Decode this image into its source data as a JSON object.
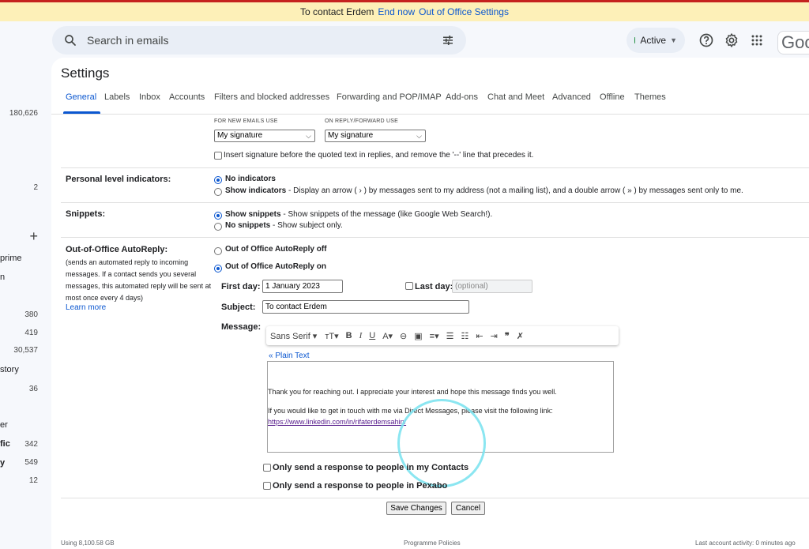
{
  "banner": {
    "text": "To contact Erdem",
    "end_now": "End now",
    "settings_link": "Out of Office Settings"
  },
  "left_sidebar": {
    "counts": [
      "180,626",
      "2",
      "380",
      "419",
      "30,537",
      "36",
      "342",
      "549",
      "12"
    ],
    "labels": [
      "prime",
      "n",
      "story",
      "er",
      "fic",
      "y"
    ],
    "plus": "+"
  },
  "header": {
    "search_placeholder": "Search in emails",
    "status": "Active",
    "logo": "Goog"
  },
  "settings": {
    "title": "Settings",
    "tabs": [
      "General",
      "Labels",
      "Inbox",
      "Accounts",
      "Filters and blocked addresses",
      "Forwarding and POP/IMAP",
      "Add-ons",
      "Chat and Meet",
      "Advanced",
      "Offline",
      "Themes"
    ]
  },
  "signature": {
    "new_label": "FOR NEW EMAILS USE",
    "reply_label": "ON REPLY/FORWARD USE",
    "new_value": "My signature",
    "reply_value": "My signature",
    "insert_text": "Insert signature before the quoted text in replies, and remove the '--' line that precedes it."
  },
  "personal_indicators": {
    "label": "Personal level indicators:",
    "opt1": "No indicators",
    "opt2": "Show indicators",
    "opt2_desc": " - Display an arrow ( › ) by messages sent to my address (not a mailing list), and a double arrow ( » ) by messages sent only to me."
  },
  "snippets": {
    "label": "Snippets:",
    "opt1": "Show snippets",
    "opt1_desc": " - Show snippets of the message (like Google Web Search!).",
    "opt2": "No snippets",
    "opt2_desc": " - Show subject only."
  },
  "autoreply": {
    "label": "Out-of-Office AutoReply:",
    "desc": "(sends an automated reply to incoming messages. If a contact sends you several messages, this automated reply will be sent at most once every 4 days)",
    "learn_more": "Learn more",
    "off_label": "Out of Office AutoReply off",
    "on_label": "Out of Office AutoReply on",
    "first_day_label": "First day:",
    "first_day_value": "1 January 2023",
    "last_day_label": "Last day:",
    "last_day_placeholder": "(optional)",
    "subject_label": "Subject:",
    "subject_value": "To contact Erdem",
    "message_label": "Message:",
    "font_name": "Sans Serif",
    "plain_text": "« Plain Text",
    "body_line1": "Thank you for reaching out. I appreciate your interest and hope this message finds you well.",
    "body_line2": "If you would like to get in touch with me via Direct Messages, please visit the following link:",
    "body_link": "https://www.linkedin.com/in/rifaterdemsahin/",
    "contacts_only": "Only send a response to people in my Contacts",
    "pexabo_only": "Only send a response to people in Pexabo"
  },
  "actions": {
    "save": "Save Changes",
    "cancel": "Cancel"
  },
  "footer": {
    "storage": "Using 8,100.58 GB",
    "policies": "Programme Policies",
    "activity": "Last account activity: 0 minutes ago"
  },
  "colors": {
    "accent": "#0b57d0",
    "banner_bg": "#fdf0b8",
    "active_dot": "#1e8e3e"
  }
}
